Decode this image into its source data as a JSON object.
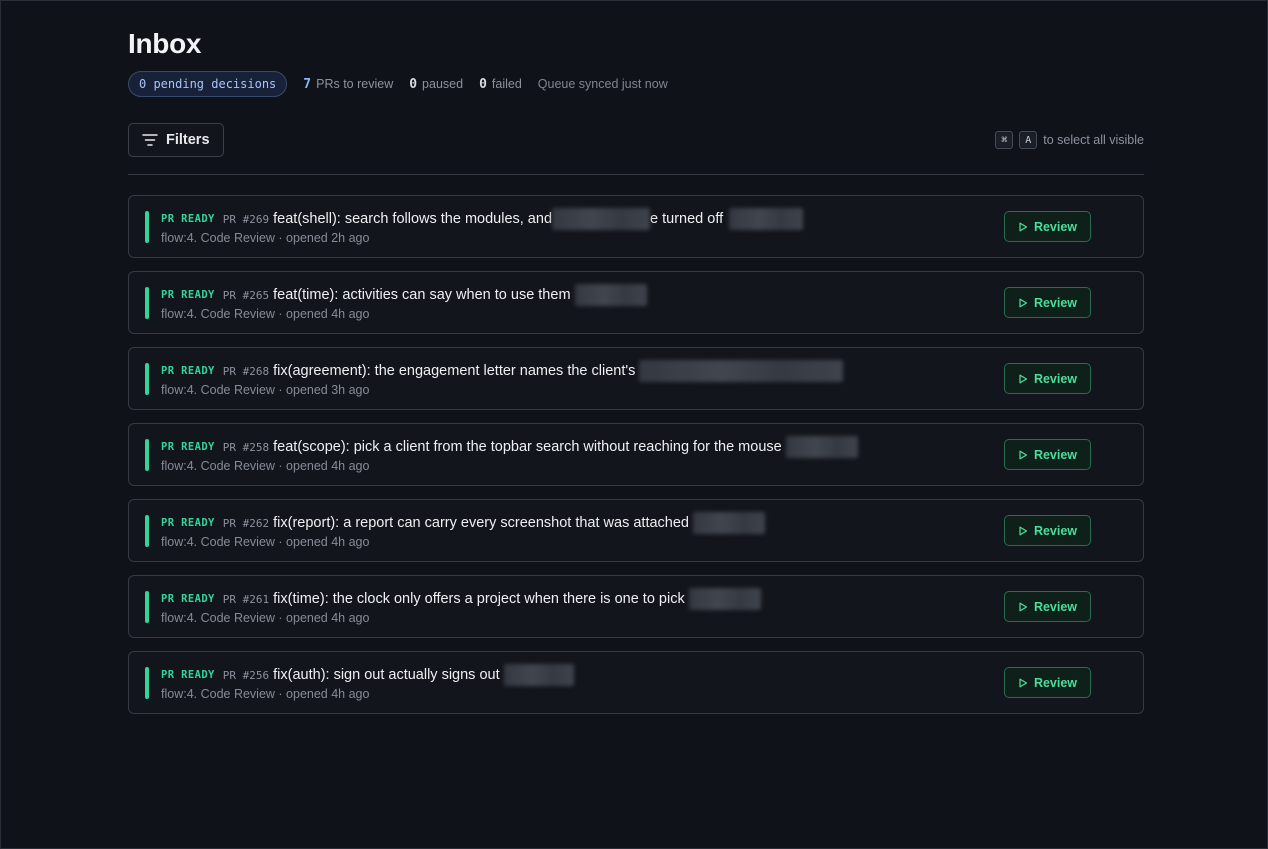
{
  "header": {
    "title": "Inbox",
    "pending_label": "0 pending decisions",
    "stats": [
      {
        "value": "7",
        "label": "PRs to review"
      },
      {
        "value": "0",
        "label": "paused"
      },
      {
        "value": "0",
        "label": "failed"
      }
    ],
    "synced": "Queue synced just now"
  },
  "toolbar": {
    "filters_label": "Filters",
    "filters_icon": "filter-lines-icon",
    "shortcut_keys": [
      "⌘",
      "A"
    ],
    "shortcut_hint": "to select all visible"
  },
  "colors": {
    "accent_green": "#34d399",
    "accent_blue": "#8ab4f8",
    "background": "#0f1218"
  },
  "items": [
    {
      "badge": "PR READY",
      "num": "PR #269",
      "title_a": "feat(shell): search follows the modules, and ",
      "title_b": "e turned off",
      "meta": "flow:4. Code Review · opened 2h ago",
      "action": "Review"
    },
    {
      "badge": "PR READY",
      "num": "PR #265",
      "title_a": "feat(time): activities can say when to use them",
      "title_b": "",
      "meta": "flow:4. Code Review · opened 4h ago",
      "action": "Review"
    },
    {
      "badge": "PR READY",
      "num": "PR #268",
      "title_a": "fix(agreement): the engagement letter names the client's",
      "title_b": "",
      "meta": "flow:4. Code Review · opened 3h ago",
      "action": "Review"
    },
    {
      "badge": "PR READY",
      "num": "PR #258",
      "title_a": "feat(scope): pick a client from the topbar search without reaching for the mouse",
      "title_b": "",
      "meta": "flow:4. Code Review · opened 4h ago",
      "action": "Review"
    },
    {
      "badge": "PR READY",
      "num": "PR #262",
      "title_a": "fix(report): a report can carry every screenshot that was attached",
      "title_b": "",
      "meta": "flow:4. Code Review · opened 4h ago",
      "action": "Review"
    },
    {
      "badge": "PR READY",
      "num": "PR #261",
      "title_a": "fix(time): the clock only offers a project when there is one to pick",
      "title_b": "",
      "meta": "flow:4. Code Review · opened 4h ago",
      "action": "Review"
    },
    {
      "badge": "PR READY",
      "num": "PR #256",
      "title_a": "fix(auth): sign out actually signs out",
      "title_b": "",
      "meta": "flow:4. Code Review · opened 4h ago",
      "action": "Review"
    }
  ]
}
